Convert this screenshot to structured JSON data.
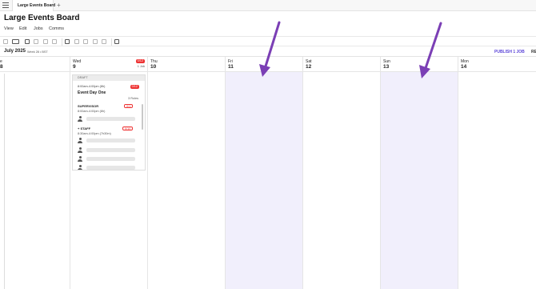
{
  "app": {
    "tab_title": "Large Events Board",
    "tab_add": "+",
    "page_title": "Large Events Board"
  },
  "menu": [
    {
      "label": "View"
    },
    {
      "label": "Edit"
    },
    {
      "label": "Jobs"
    },
    {
      "label": "Comms"
    }
  ],
  "toolbar": {
    "icons": [
      "undo-icon",
      "copy-icon",
      "smart-assign-icon",
      "delete-icon",
      "archive-icon",
      "split-icon",
      "add-job-icon",
      "copy-job-icon",
      "edit-icon",
      "repeat-icon",
      "person-icon",
      "calendar-icon"
    ]
  },
  "subheader": {
    "month": "July 2025",
    "week": "Week 28 • BST",
    "publish": "PUBLISH 1 JOB",
    "re": "RE"
  },
  "calendar": {
    "left_fragment": {
      "day": "e",
      "num": "8"
    },
    "days": [
      {
        "name": "Wed",
        "num": "9",
        "badge": "0/12",
        "sub": "1 Job"
      },
      {
        "name": "Thu",
        "num": "10"
      },
      {
        "name": "Fri",
        "num": "11"
      },
      {
        "name": "Sat",
        "num": "12"
      },
      {
        "name": "Sun",
        "num": "13"
      },
      {
        "name": "Mon",
        "num": "14"
      }
    ]
  },
  "job_card": {
    "status": "DRAFT",
    "time": "8:00am-4:00pm (8h)",
    "badge": "0/12",
    "name": "Event Day One",
    "roles_count": "3 Roles",
    "roles": [
      {
        "title": "SUPERVISOR",
        "badge": "0/1",
        "time": "8:00am-4:00pm (8h)"
      },
      {
        "title": "+ STAFF",
        "badge": "0/10",
        "time": "8:30am-4:00pm (7h30m)"
      }
    ]
  },
  "colors": {
    "accent": "#5b45d8",
    "highlight": "#f1effc",
    "badge_red": "#e33",
    "arrow": "#7b3fb5"
  }
}
